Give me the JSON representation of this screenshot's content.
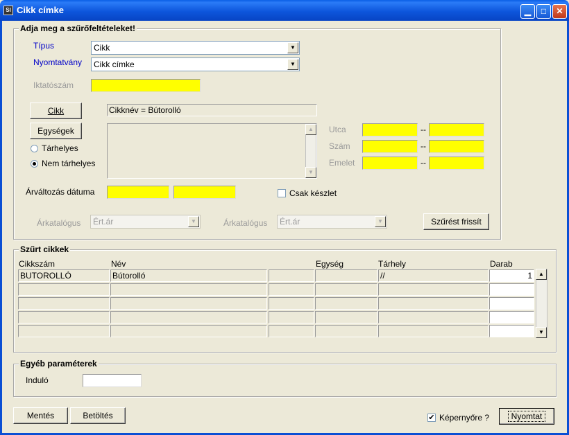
{
  "window": {
    "title": "Cikk címke",
    "icon": "app-icon",
    "buttons": [
      "minimize",
      "maximize",
      "close"
    ]
  },
  "filters": {
    "legend": "Adja meg a szűrőfeltételeket!",
    "tipus_label": "Típus",
    "tipus_value": "Cikk",
    "nyomtatvany_label": "Nyomtatvány",
    "nyomtatvany_value": "Cikk címke",
    "iktatoszam_label": "Iktatószám",
    "cikk_button": "Cikk",
    "cikknev_display": "Cikknév = Bútorolló",
    "egysegek_button": "Egységek",
    "tarhelyes_label": "Tárhelyes",
    "nem_tarhelyes_label": "Nem tárhelyes",
    "selected_radio": "Nem tárhelyes",
    "utca_label": "Utca",
    "szam_label": "Szám",
    "emelet_label": "Emelet",
    "range_separator": "--",
    "arvaltozas_label": "Árváltozás dátuma",
    "csak_keszlet_label": "Csak készlet",
    "csak_keszlet_checked": false,
    "arkatalogus1_label": "Árkatalógus",
    "arkatalogus1_value": "Ért.ár",
    "arkatalogus2_label": "Árkatalógus",
    "arkatalogus2_value": "Ért.ár",
    "szurest_frissit_button": "Szűrést frissít"
  },
  "results": {
    "legend": "Szűrt cikkek",
    "columns": [
      "Cikkszám",
      "Név",
      "Egység",
      "Tárhely",
      "Darab"
    ],
    "rows": [
      {
        "cikkszam": "BUTOROLLÓ",
        "nev": "Bútorolló",
        "blank": "",
        "egyseg": "",
        "tarhely": "//",
        "darab": "1"
      },
      {
        "cikkszam": "",
        "nev": "",
        "blank": "",
        "egyseg": "",
        "tarhely": "",
        "darab": ""
      },
      {
        "cikkszam": "",
        "nev": "",
        "blank": "",
        "egyseg": "",
        "tarhely": "",
        "darab": ""
      },
      {
        "cikkszam": "",
        "nev": "",
        "blank": "",
        "egyseg": "",
        "tarhely": "",
        "darab": ""
      },
      {
        "cikkszam": "",
        "nev": "",
        "blank": "",
        "egyseg": "",
        "tarhely": "",
        "darab": ""
      }
    ]
  },
  "other": {
    "legend": "Egyéb paraméterek",
    "indulo_label": "Induló",
    "indulo_value": ""
  },
  "footer": {
    "mentes_button": "Mentés",
    "betoltes_button": "Betöltés",
    "kepernyore_label": "Képernyőre ?",
    "kepernyore_checked": true,
    "nyomtat_button": "Nyomtat"
  },
  "colors": {
    "titlebar": "#0a5fe6",
    "field_highlight": "#ffff00",
    "window_bg": "#ece9d8",
    "label_blue": "#0000c8"
  }
}
